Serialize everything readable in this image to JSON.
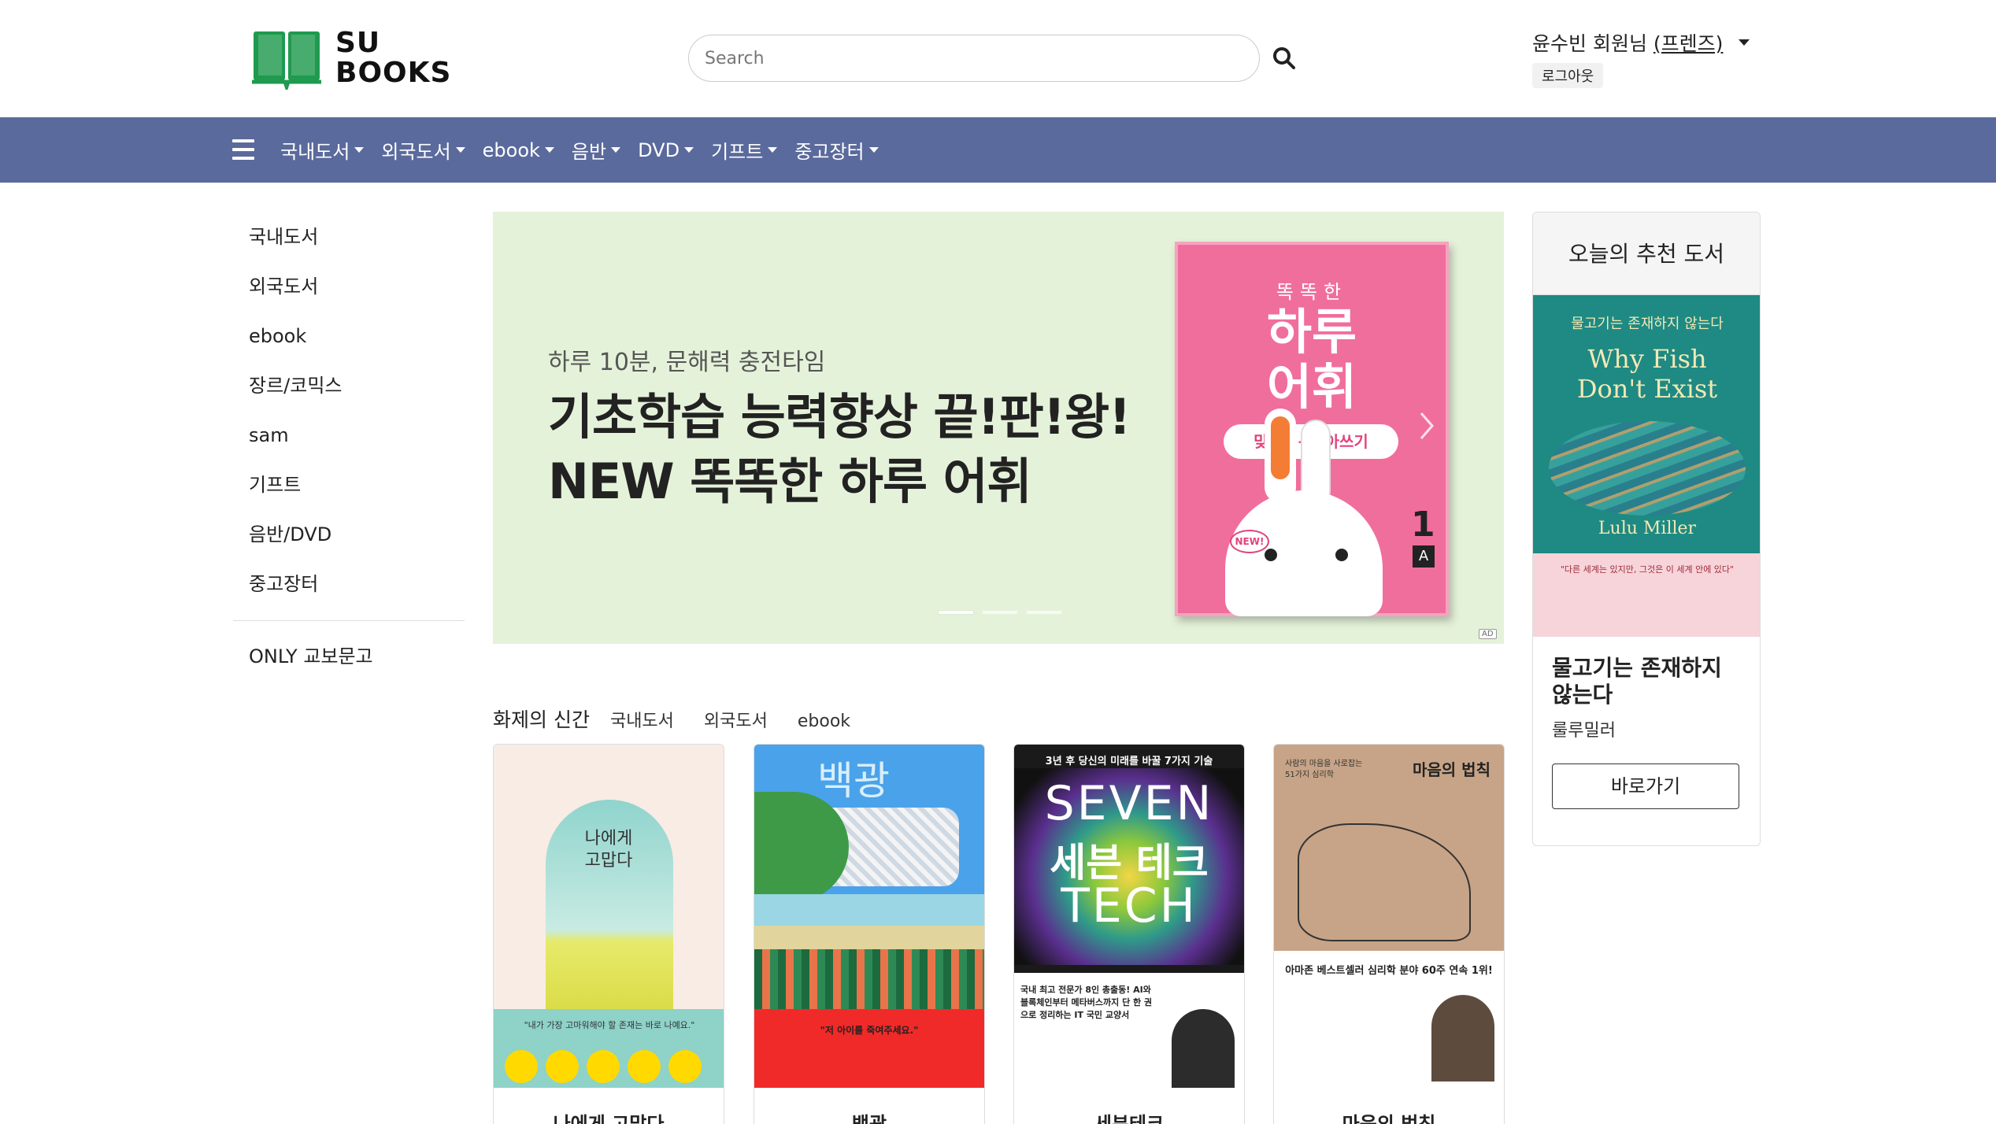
{
  "header": {
    "logo_line1": "SU",
    "logo_line2": "BOOKS",
    "search_placeholder": "Search",
    "user_name": "윤수빈 회원님",
    "user_grade": "(프렌즈)",
    "logout_label": "로그아웃"
  },
  "nav": {
    "items": [
      "국내도서",
      "외국도서",
      "ebook",
      "음반",
      "DVD",
      "기프트",
      "중고장터"
    ]
  },
  "sidebar": {
    "items": [
      "국내도서",
      "외국도서",
      "ebook",
      "장르/코믹스",
      "sam",
      "기프트",
      "음반/DVD",
      "중고장터"
    ],
    "extra": "ONLY 교보문고"
  },
  "banner": {
    "subtitle": "하루 10분, 문해력 충전타임",
    "title_line1": "기초학습 능력향상 끝!판!왕!",
    "title_line2": "NEW 똑똑한 하루 어휘",
    "book_top": "똑똑한",
    "book_title_line1": "하루",
    "book_title_line2": "어휘",
    "book_pill": "맞춤법+받아쓰기",
    "book_level": "1",
    "book_grade": "A",
    "book_new": "NEW!",
    "ad": "AD",
    "slide_count": 3,
    "active_slide": 1
  },
  "new_books": {
    "title": "화제의 신간",
    "tabs": [
      "국내도서",
      "외국도서",
      "ebook"
    ],
    "books": [
      {
        "title": "나에게 고맙다",
        "cover_text": "나에게\n고맙다",
        "blurb": "\"내가 가장 고마워해야 할 존재는 바로 나예요.\""
      },
      {
        "title": "백광",
        "cover_text": "백광",
        "blurb": "\"저 아이를 죽여주세요.\""
      },
      {
        "title": "세븐테크",
        "cover_top": "3년 후 당신의 미래를 바꿀 7가지 기술",
        "cover_a": "SEVEN",
        "cover_b": "세븐 테크",
        "cover_c": "TECH",
        "blurb": "국내 최고 전문가 8인 총출동! AI와 블록체인부터 메타버스까지 단 한 권으로 정리하는 IT 국민 교양서"
      },
      {
        "title": "마음의 법칙",
        "cover_text": "마음의 법칙",
        "cover_small": "사람의 마음을 사로잡는\n51가지 심리학",
        "blurb": "아마존 베스트셀러 심리학 분야 60주 연속 1위!"
      }
    ]
  },
  "recommend": {
    "heading": "오늘의 추천 도서",
    "cover_kor": "물고기는 존재하지 않는다",
    "cover_eng_line1": "Why Fish",
    "cover_eng_line2": "Don't Exist",
    "cover_author": "Lulu Miller",
    "cover_quote": "\"다른 세계는 있지만, 그것은 이 세계 안에 있다\"",
    "title": "물고기는 존재하지 않는다",
    "author": "룰루밀러",
    "button": "바로가기"
  }
}
